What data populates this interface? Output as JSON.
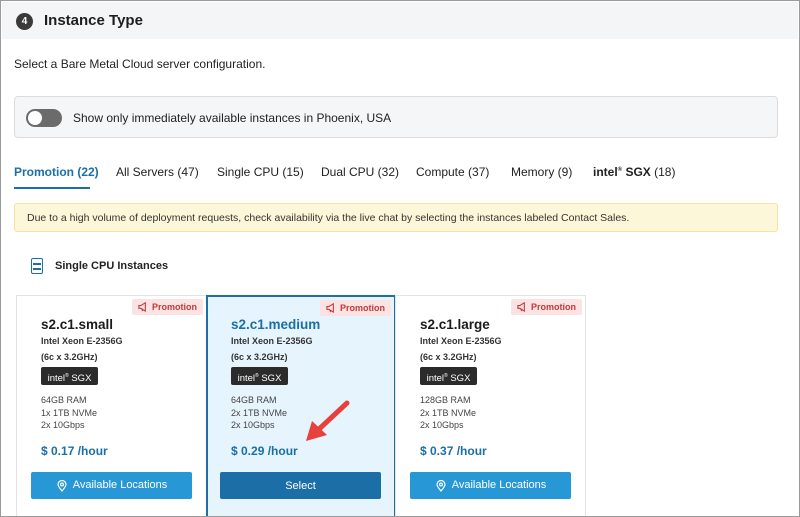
{
  "section": {
    "step_number": "4",
    "title": "Instance Type",
    "description": "Select a Bare Metal Cloud server configuration."
  },
  "filter": {
    "toggle_on": false,
    "label": "Show only immediately available instances in Phoenix, USA"
  },
  "tabs": [
    {
      "label": "Promotion (22)",
      "active": true
    },
    {
      "label": "All Servers (47)",
      "active": false
    },
    {
      "label": "Single CPU (15)",
      "active": false
    },
    {
      "label": "Dual CPU (32)",
      "active": false
    },
    {
      "label": "Compute (37)",
      "active": false
    },
    {
      "label": "Memory (9)",
      "active": false
    },
    {
      "label_brand": "intel",
      "label_suffix": "SGX",
      "label_count": "(18)",
      "active": false
    }
  ],
  "notice": "Due to a high volume of deployment requests, check availability via the live chat by selecting the instances labeled Contact Sales.",
  "group": {
    "icon": "server-icon",
    "title": "Single CPU Instances"
  },
  "cards": [
    {
      "badge": "Promotion",
      "name": "s2.c1.small",
      "cpu": "Intel Xeon E-2356G",
      "cores": "(6c x 3.2GHz)",
      "sgx_brand": "intel",
      "sgx_label": "SGX",
      "ram": "64GB RAM",
      "storage": "1x 1TB NVMe",
      "network": "2x 10Gbps",
      "price": "$ 0.17 /hour",
      "button": "Available Locations",
      "selected": false
    },
    {
      "badge": "Promotion",
      "name": "s2.c1.medium",
      "cpu": "Intel Xeon E-2356G",
      "cores": "(6c x 3.2GHz)",
      "sgx_brand": "intel",
      "sgx_label": "SGX",
      "ram": "64GB RAM",
      "storage": "2x 1TB NVMe",
      "network": "2x 10Gbps",
      "price": "$ 0.29 /hour",
      "button": "Select",
      "selected": true
    },
    {
      "badge": "Promotion",
      "name": "s2.c1.large",
      "cpu": "Intel Xeon E-2356G",
      "cores": "(6c x 3.2GHz)",
      "sgx_brand": "intel",
      "sgx_label": "SGX",
      "ram": "128GB RAM",
      "storage": "2x 1TB NVMe",
      "network": "2x 10Gbps",
      "price": "$ 0.37 /hour",
      "button": "Available Locations",
      "selected": false
    }
  ],
  "colors": {
    "accent": "#1b6fa6",
    "button": "#2897d6",
    "selected_bg": "#e6f4fd",
    "badge_bg": "#fbe3e3",
    "badge_text": "#c33a3a",
    "notice_bg": "#fdf7d9",
    "annotation_arrow": "#e8403a"
  }
}
